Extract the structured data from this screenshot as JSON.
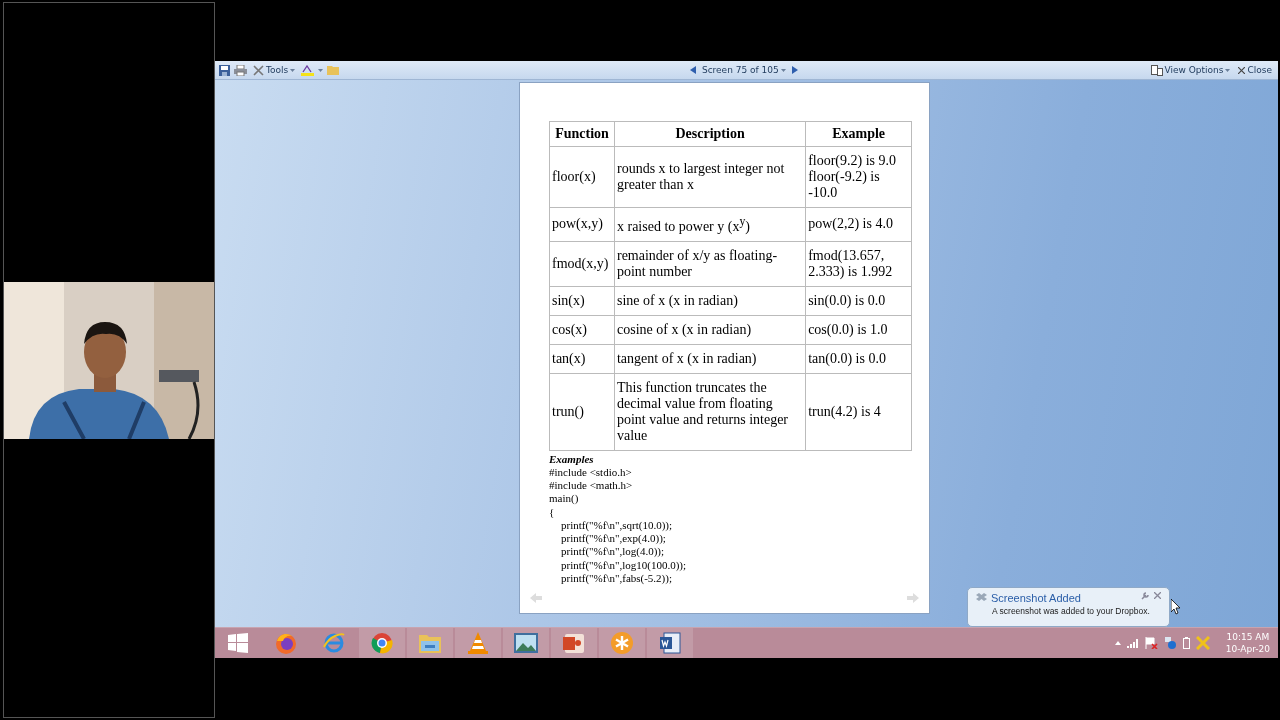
{
  "toolbar": {
    "tools_label": "Tools",
    "navigator": "Screen 75 of 105",
    "view_options": "View Options",
    "close": "Close"
  },
  "document": {
    "table": {
      "columns": [
        "Function",
        "Description",
        "Example"
      ],
      "rows": [
        {
          "cells": [
            "floor(x)",
            "rounds x to largest integer not greater than x",
            "floor(9.2) is 9.0 floor(-9.2) is -10.0"
          ]
        },
        {
          "cells": [
            "pow(x,y)",
            "x raised to power y (x$^{y}$)",
            "pow(2,2) is 4.0"
          ]
        },
        {
          "cells": [
            "fmod(x,y)",
            "remainder of x/y as floating-point number",
            "fmod(13.657, 2.333) is 1.992"
          ]
        },
        {
          "cells": [
            "sin(x)",
            "sine of x (x in radian)",
            "sin(0.0) is 0.0"
          ]
        },
        {
          "cells": [
            "cos(x)",
            "cosine of x (x in radian)",
            "cos(0.0) is 1.0"
          ]
        },
        {
          "cells": [
            "tan(x)",
            "tangent of x (x in radian)",
            "tan(0.0) is 0.0"
          ]
        },
        {
          "cells": [
            "trun()",
            "This function truncates the decimal value from floating point value and returns integer value",
            "trun(4.2) is 4"
          ]
        }
      ]
    },
    "examples_heading": "Examples",
    "code": [
      {
        "text": "#include <stdio.h>",
        "indented": false
      },
      {
        "text": "#include <math.h>",
        "indented": false
      },
      {
        "text": "main()",
        "indented": false
      },
      {
        "text": "{",
        "indented": false
      },
      {
        "text": "printf(\"%f\\n\",sqrt(10.0));",
        "indented": true
      },
      {
        "text": "printf(\"%f\\n\",exp(4.0));",
        "indented": true
      },
      {
        "text": "printf(\"%f\\n\",log(4.0));",
        "indented": true
      },
      {
        "text": "printf(\"%f\\n\",log10(100.0));",
        "indented": true
      },
      {
        "text": "printf(\"%f\\n\",fabs(-5.2));",
        "indented": true
      }
    ]
  },
  "notification": {
    "title": "Screenshot Added",
    "message": "A screenshot was added to your Dropbox."
  },
  "clock": {
    "time": "10:15 AM",
    "date": "10-Apr-20"
  }
}
